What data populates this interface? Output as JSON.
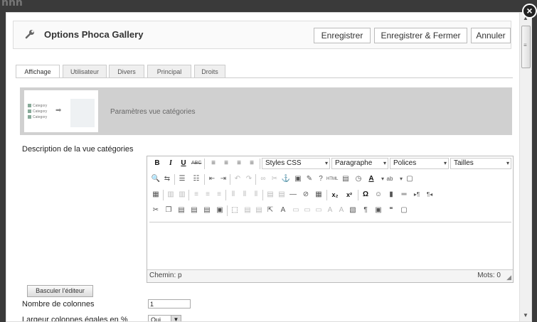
{
  "background_text": "nnn",
  "close_glyph": "×",
  "window": {
    "title": "Options Phoca Gallery",
    "buttons": {
      "save": "Enregistrer",
      "save_close": "Enregistrer & Fermer",
      "cancel": "Annuler"
    }
  },
  "tabs": [
    "Affichage",
    "Utilisateur",
    "Divers",
    "Principal",
    "Droits"
  ],
  "banner": {
    "label": "Paramètres vue catégories",
    "thumb_items": [
      "Category",
      "Category",
      "Category"
    ]
  },
  "editor_section": {
    "label": "Description de la vue catégories",
    "selects": {
      "styles": "Styles CSS",
      "format": "Paragraphe",
      "fonts": "Polices",
      "sizes": "Tailles"
    },
    "status_path": "Chemin: p",
    "word_count": "Mots: 0"
  },
  "toggle_editor_button": "Basculer l'éditeur",
  "columns": {
    "label": "Nombre de colonnes",
    "value": "1"
  },
  "equal_width": {
    "label": "Largeur colonnes égales en %",
    "value": "Oui"
  }
}
